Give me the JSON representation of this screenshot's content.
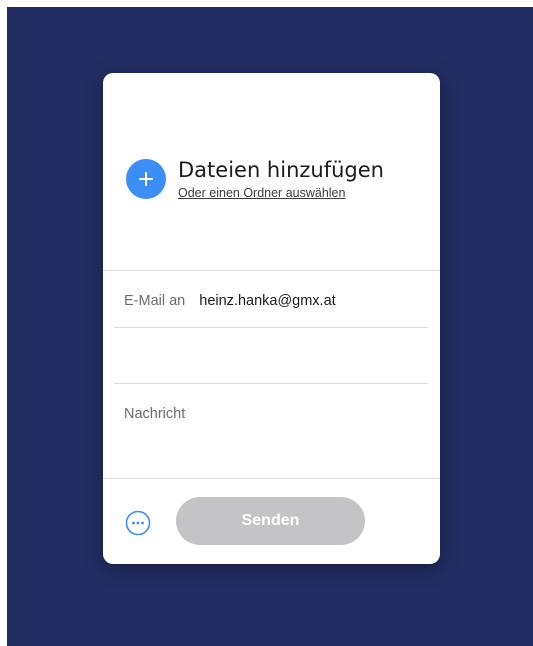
{
  "upload": {
    "title": "Dateien hinzufügen",
    "subtitle": "Oder einen Ordner auswählen",
    "add_icon": "plus-icon",
    "accent_color": "#3a8ef6"
  },
  "recipient": {
    "label": "E-Mail an",
    "value": "heinz.hanka@gmx.at"
  },
  "message": {
    "placeholder": "Nachricht"
  },
  "footer": {
    "more_icon": "more-options-icon",
    "send_label": "Senden",
    "send_color": "#c4c4c7"
  },
  "colors": {
    "background": "#222d63",
    "card": "#ffffff"
  }
}
